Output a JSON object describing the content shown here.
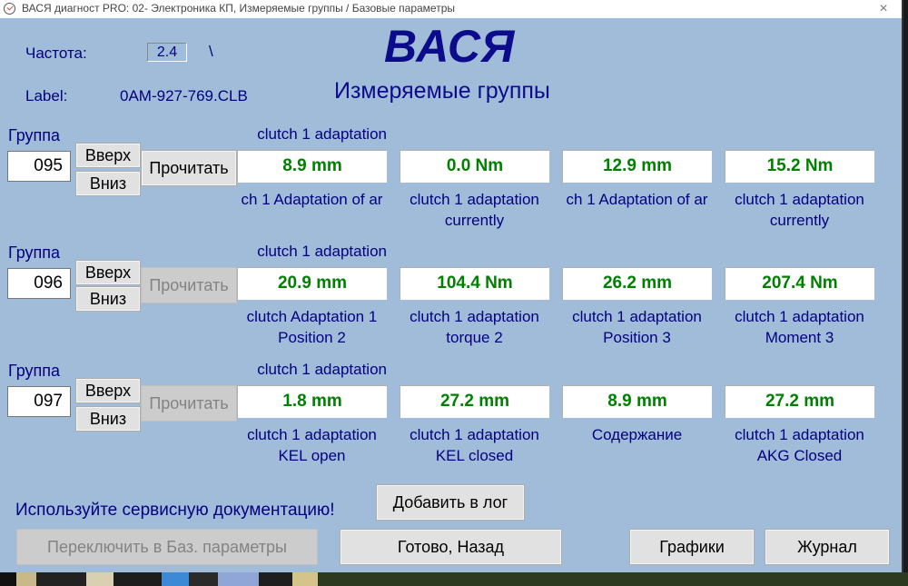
{
  "window": {
    "title": "ВАСЯ диагност PRO: 02- Электроника КП,  Измеряемые группы / Базовые параметры",
    "close_icon": "×"
  },
  "header": {
    "freq_label": "Частота:",
    "freq_value": "2.4",
    "freq_indicator": "\\",
    "label_label": "Label:",
    "label_value": "0AM-927-769.CLB",
    "brand": "ВАСЯ",
    "subtitle": "Измеряемые группы"
  },
  "groups": [
    {
      "label": "Группа",
      "number": "095",
      "up_label": "Вверх",
      "down_label": "Вниз",
      "read_label": "Прочитать",
      "read_enabled": true,
      "title": "clutch 1 adaptation",
      "values": [
        {
          "value": "8.9 mm",
          "caption1": "ch 1 Adaptation of ar",
          "caption2": ""
        },
        {
          "value": "0.0 Nm",
          "caption1": "clutch 1 adaptation",
          "caption2": "currently"
        },
        {
          "value": "12.9 mm",
          "caption1": "ch 1 Adaptation of ar",
          "caption2": ""
        },
        {
          "value": "15.2 Nm",
          "caption1": "clutch 1 adaptation",
          "caption2": "currently"
        }
      ]
    },
    {
      "label": "Группа",
      "number": "096",
      "up_label": "Вверх",
      "down_label": "Вниз",
      "read_label": "Прочитать",
      "read_enabled": false,
      "title": "clutch 1 adaptation",
      "values": [
        {
          "value": "20.9 mm",
          "caption1": "clutch Adaptation 1",
          "caption2": "Position 2"
        },
        {
          "value": "104.4 Nm",
          "caption1": "clutch 1 adaptation",
          "caption2": "torque 2"
        },
        {
          "value": "26.2 mm",
          "caption1": "clutch 1 adaptation",
          "caption2": "Position 3"
        },
        {
          "value": "207.4 Nm",
          "caption1": "clutch 1 adaptation",
          "caption2": "Moment 3"
        }
      ]
    },
    {
      "label": "Группа",
      "number": "097",
      "up_label": "Вверх",
      "down_label": "Вниз",
      "read_label": "Прочитать",
      "read_enabled": false,
      "title": "clutch 1 adaptation",
      "values": [
        {
          "value": "1.8 mm",
          "caption1": "clutch 1 adaptation",
          "caption2": "KEL open"
        },
        {
          "value": "27.2 mm",
          "caption1": "clutch 1 adaptation",
          "caption2": "KEL closed"
        },
        {
          "value": "8.9 mm",
          "caption1": "Содержание",
          "caption2": ""
        },
        {
          "value": "27.2 mm",
          "caption1": "clutch 1 adaptation",
          "caption2": "AKG Closed"
        }
      ]
    }
  ],
  "footer": {
    "notice": "Используйте сервисную документацию!",
    "add_log_label": "Добавить в лог",
    "switch_basic_label": "Переключить в Баз. параметры",
    "done_back_label": "Готово, Назад",
    "graphs_label": "Графики",
    "journal_label": "Журнал"
  },
  "colors": {
    "background": "#a0bcd9",
    "label_text": "#000080",
    "value_text": "#008000",
    "brand_text": "#0b0b8c"
  }
}
